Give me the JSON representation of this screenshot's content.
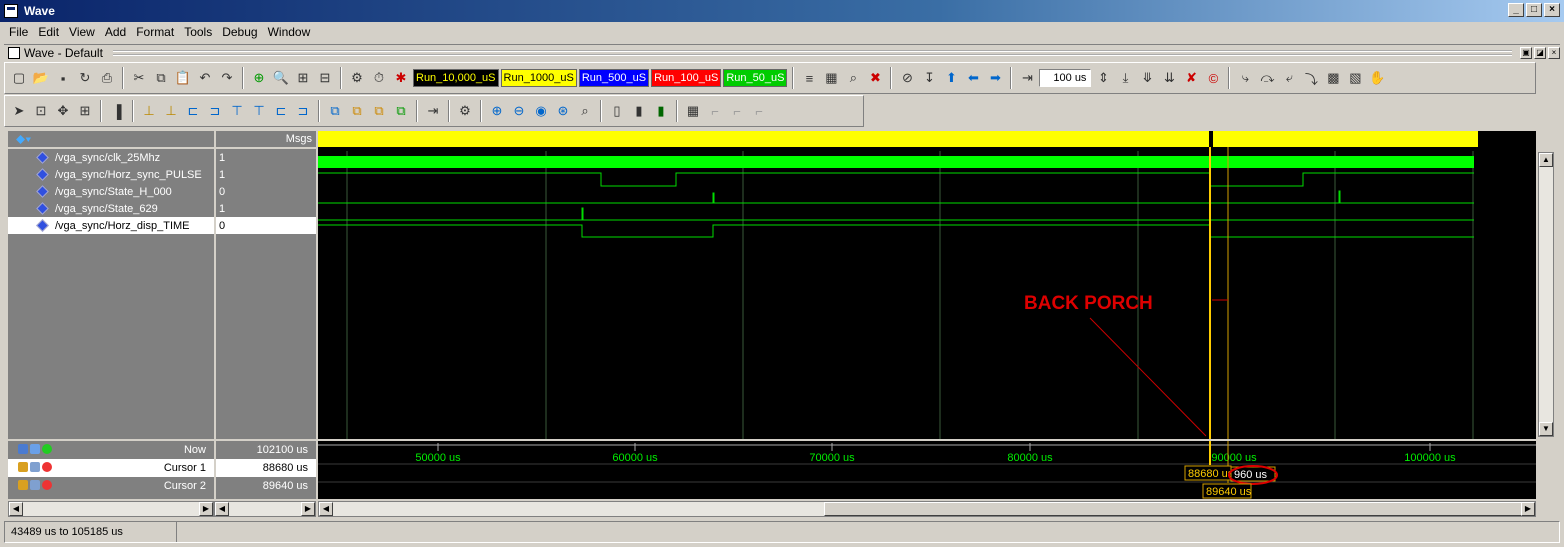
{
  "window": {
    "title": "Wave",
    "controls": [
      "_",
      "□",
      "×"
    ]
  },
  "menu": [
    "File",
    "Edit",
    "View",
    "Add",
    "Format",
    "Tools",
    "Debug",
    "Window"
  ],
  "subwindow": {
    "title": "Wave - Default"
  },
  "toolbar": {
    "run_buttons": [
      {
        "label": "Run_10,000_uS",
        "bg": "#000000",
        "fg": "#ffff00"
      },
      {
        "label": "Run_1000_uS",
        "bg": "#ffff00",
        "fg": "#000000"
      },
      {
        "label": "Run_500_uS",
        "bg": "#0000ff",
        "fg": "#ffffff"
      },
      {
        "label": "Run_100_uS",
        "bg": "#ff0000",
        "fg": "#ffffff"
      },
      {
        "label": "Run_50_uS",
        "bg": "#00cc00",
        "fg": "#ffffff"
      }
    ],
    "zoom_value": "100 us"
  },
  "signals": {
    "msgs_header": "Msgs",
    "rows": [
      {
        "name": "/vga_sync/clk_25Mhz",
        "value": "1"
      },
      {
        "name": "/vga_sync/Horz_sync_PULSE",
        "value": "1"
      },
      {
        "name": "/vga_sync/State_H_000",
        "value": "0"
      },
      {
        "name": "/vga_sync/State_629",
        "value": "1"
      },
      {
        "name": "/vga_sync/Horz_disp_TIME",
        "value": "0"
      }
    ]
  },
  "cursors": {
    "now_label": "Now",
    "now_value": "102100 us",
    "rows": [
      {
        "name": "Cursor 1",
        "value": "88680 us"
      },
      {
        "name": "Cursor 2",
        "value": "89640 us"
      }
    ],
    "cursor1_tag": "88680 us",
    "cursor2_tag": "89640 us",
    "delta_tag": "960 us"
  },
  "timeline": {
    "ticks": [
      "50000 us",
      "60000 us",
      "70000 us",
      "80000 us",
      "90000 us",
      "100000 us"
    ]
  },
  "annotation": {
    "text": "BACK PORCH"
  },
  "status": {
    "range": "43489 us to 105185 us"
  }
}
